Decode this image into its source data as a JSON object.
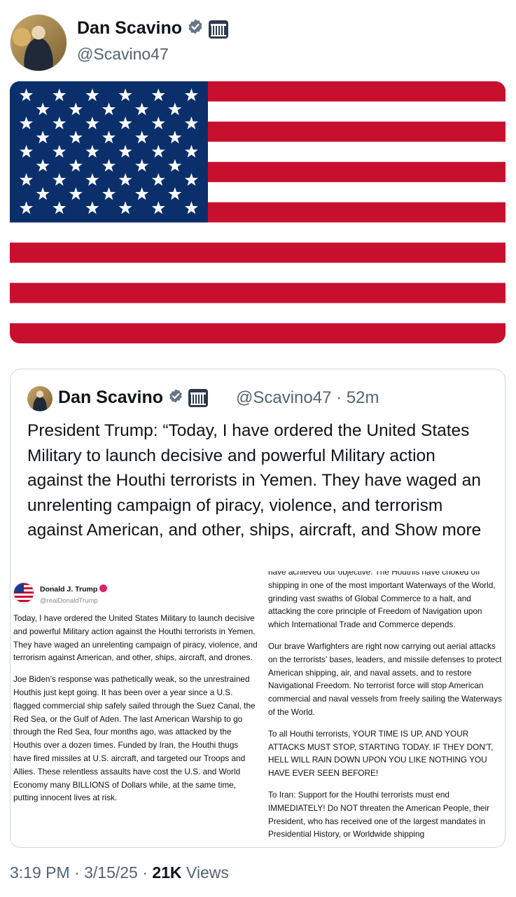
{
  "author": {
    "name": "Dan Scavino",
    "handle": "@Scavino47"
  },
  "colors": {
    "flag_red": "#c8102e",
    "flag_blue": "#0a2f6b",
    "verified_blue": "#657786",
    "text_secondary": "#536471"
  },
  "icons": [
    "verified-badge-icon",
    "white-house-icon",
    "flag-image"
  ],
  "quote": {
    "name": "Dan Scavino",
    "handle": "@Scavino47",
    "separator": "·",
    "time": "52m",
    "text": "President Trump: “Today, I have ordered the United States Military to launch decisive and powerful Military action against the Houthi terrorists in Yemen. They have waged an unrelenting campaign of piracy, violence, and terrorism against American, and other, ships, aircraft, and",
    "show_more": "Show more",
    "embed": {
      "name": "Donald J. Trump",
      "handle": "@realDonaldTrump",
      "left_paragraphs": [
        "Today, I have ordered the United States Military to launch decisive and powerful Military action against the Houthi terrorists in Yemen. They have waged an unrelenting campaign of piracy, violence, and terrorism against American, and other, ships, aircraft, and drones.",
        "Joe Biden’s response was pathetically weak, so the unrestrained Houthis just kept going. It has been over a year since a U.S. flagged commercial ship safely sailed through the Suez Canal, the Red Sea, or the Gulf of Aden. The last American Warship to go through the Red Sea, four months ago, was attacked by the Houthis over a dozen times. Funded by Iran, the Houthi thugs have fired missiles at U.S. aircraft, and targeted our Troops and Allies. These relentless assaults have cost the U.S. and World Economy many BILLIONS of Dollars while, at the same time, putting innocent lives at risk."
      ],
      "right_paragraphs": [
        "have achieved our objective. The Houthis have choked off shipping in one of the most important Waterways of the World, grinding vast swaths of Global Commerce to a halt, and attacking the core principle of Freedom of Navigation upon which International Trade and Commerce depends.",
        "Our brave Warfighters are right now carrying out aerial attacks on the terrorists' bases, leaders, and missile defenses to protect American shipping, air, and naval assets, and to restore Navigational Freedom. No terrorist force will stop American commercial and naval vessels from freely sailing the Waterways of the World.",
        "To all Houthi terrorists, YOUR TIME IS UP, AND YOUR ATTACKS MUST STOP, STARTING TODAY. IF THEY DON'T, HELL WILL RAIN DOWN UPON YOU LIKE NOTHING YOU HAVE EVER SEEN BEFORE!",
        "To Iran: Support for the Houthi terrorists must end IMMEDIATELY! Do NOT threaten the American People, their President, who has received one of the largest mandates in Presidential History, or Worldwide shipping"
      ]
    }
  },
  "footer": {
    "time": "3:19 PM",
    "separator": "·",
    "date": "3/15/25",
    "views_count": "21K",
    "views_label": "Views"
  }
}
